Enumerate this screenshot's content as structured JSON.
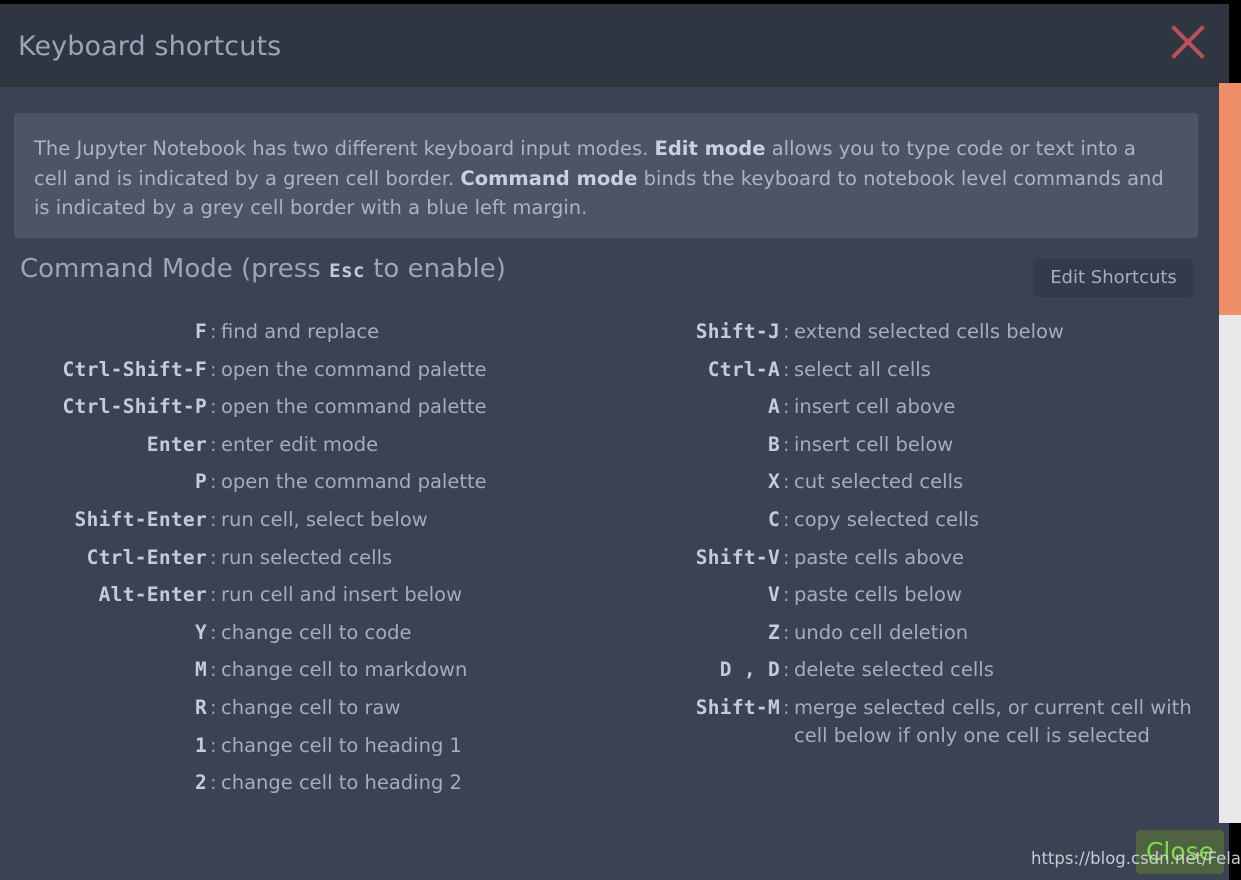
{
  "dialog": {
    "title": "Keyboard shortcuts",
    "close_icon": "close-icon"
  },
  "info": {
    "part1": "The Jupyter Notebook has two different keyboard input modes. ",
    "bold1": "Edit mode",
    "part2": " allows you to type code or text into a cell and is indicated by a green cell border. ",
    "bold2": "Command mode",
    "part3": " binds the keyboard to notebook level commands and is indicated by a grey cell border with a blue left margin."
  },
  "section": {
    "title_prefix": "Command Mode (press ",
    "title_key": "Esc",
    "title_suffix": " to enable)",
    "edit_shortcuts_label": "Edit Shortcuts"
  },
  "shortcuts": {
    "separator": ":",
    "left": [
      {
        "key": "F",
        "desc": "find and replace"
      },
      {
        "key": "Ctrl-Shift-F",
        "desc": "open the command palette"
      },
      {
        "key": "Ctrl-Shift-P",
        "desc": "open the command palette"
      },
      {
        "key": "Enter",
        "desc": "enter edit mode"
      },
      {
        "key": "P",
        "desc": "open the command palette"
      },
      {
        "key": "Shift-Enter",
        "desc": "run cell, select below"
      },
      {
        "key": "Ctrl-Enter",
        "desc": "run selected cells"
      },
      {
        "key": "Alt-Enter",
        "desc": "run cell and insert below"
      },
      {
        "key": "Y",
        "desc": "change cell to code"
      },
      {
        "key": "M",
        "desc": "change cell to markdown"
      },
      {
        "key": "R",
        "desc": "change cell to raw"
      },
      {
        "key": "1",
        "desc": "change cell to heading 1"
      },
      {
        "key": "2",
        "desc": "change cell to heading 2"
      }
    ],
    "right": [
      {
        "key": "Shift-J",
        "desc": "extend selected cells below"
      },
      {
        "key": "Ctrl-A",
        "desc": "select all cells"
      },
      {
        "key": "A",
        "desc": "insert cell above"
      },
      {
        "key": "B",
        "desc": "insert cell below"
      },
      {
        "key": "X",
        "desc": "cut selected cells"
      },
      {
        "key": "C",
        "desc": "copy selected cells"
      },
      {
        "key": "Shift-V",
        "desc": "paste cells above"
      },
      {
        "key": "V",
        "desc": "paste cells below"
      },
      {
        "key": "Z",
        "desc": "undo cell deletion"
      },
      {
        "key": "D , D",
        "desc": "delete selected cells"
      },
      {
        "key": "Shift-M",
        "desc": "merge selected cells, or current cell with cell below if only one cell is selected"
      }
    ]
  },
  "footer": {
    "close_label": "Close",
    "watermark": "https://blog.csdn.net/Felaim"
  },
  "colors": {
    "dialog_bg": "#3a4254",
    "titlebar_bg": "#2f3642",
    "info_bg": "#4c5466",
    "scrollbar_thumb": "#ee8f69",
    "scrollbar_track": "#e8e8e8",
    "close_button_bg": "#4f6340",
    "close_button_text": "#7ddc4b",
    "close_x": "#b9515a"
  }
}
